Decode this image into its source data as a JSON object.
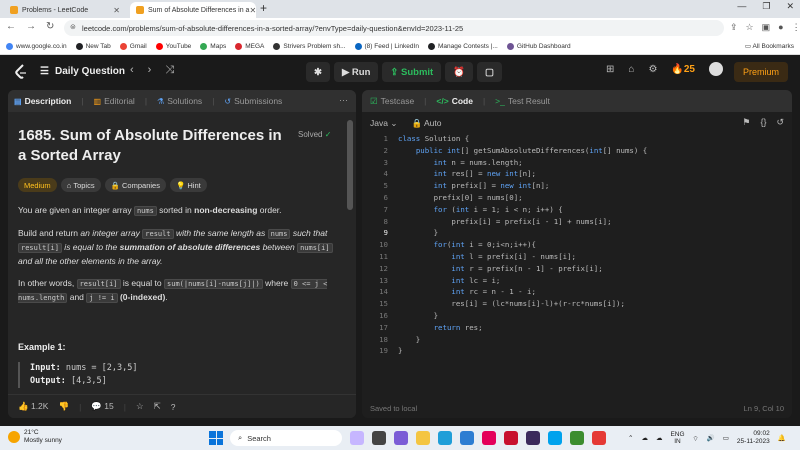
{
  "browser": {
    "tabs": [
      {
        "label": "Problems - LeetCode",
        "active": false
      },
      {
        "label": "Sum of Absolute Differences in a",
        "active": true
      }
    ],
    "url": "leetcode.com/problems/sum-of-absolute-differences-in-a-sorted-array/?envType=daily-question&envId=2023-11-25",
    "bookmarks": [
      {
        "label": "www.google.co.in",
        "color": "#4285f4"
      },
      {
        "label": "New Tab",
        "color": "#202124"
      },
      {
        "label": "Gmail",
        "color": "#ea4335"
      },
      {
        "label": "YouTube",
        "color": "#ff0000"
      },
      {
        "label": "Maps",
        "color": "#34a853"
      },
      {
        "label": "MEGA",
        "color": "#d9272e"
      },
      {
        "label": "Strivers Problem sh...",
        "color": "#333333"
      },
      {
        "label": "(8) Feed | LinkedIn",
        "color": "#0a66c2"
      },
      {
        "label": "Manage Contests |...",
        "color": "#202124"
      },
      {
        "label": "GitHub Dashboard",
        "color": "#6e5494"
      }
    ],
    "all_bookmarks": "All Bookmarks"
  },
  "header": {
    "title": "Daily Question",
    "run": "Run",
    "submit": "Submit",
    "streak": "25",
    "premium": "Premium"
  },
  "left_tabs": [
    "Description",
    "Editorial",
    "Solutions",
    "Submissions"
  ],
  "problem": {
    "title": "1685. Sum of Absolute Differences in a Sorted Array",
    "solved": "Solved",
    "tags": [
      "Medium",
      "Topics",
      "Companies",
      "Hint"
    ],
    "p1_a": "You are given an integer array ",
    "p1_code": "nums",
    "p1_b": " sorted in ",
    "p1_bold": "non-decreasing",
    "p1_c": " order.",
    "p2_a": "Build and return ",
    "p2_i1": "an integer array ",
    "p2_code1": "result",
    "p2_i2": " with the same length as ",
    "p2_code2": "nums",
    "p2_i3": " such that ",
    "p2_code3": "result[i]",
    "p2_i4": " is equal to the ",
    "p2_bold": "summation of absolute differences",
    "p2_i5": " between ",
    "p2_code4": "nums[i]",
    "p2_i6": " and all the other elements in the array.",
    "p3_a": "In other words, ",
    "p3_code1": "result[i]",
    "p3_b": " is equal to ",
    "p3_code2": "sum(|nums[i]-nums[j]|)",
    "p3_c": " where ",
    "p3_code3": "0 <= j < nums.length",
    "p3_d": " and ",
    "p3_code4": "j != i",
    "p3_bold": "(0-indexed)",
    "p3_e": ".",
    "example_title": "Example 1:",
    "input_label": "Input:",
    "input_value": "nums = [2,3,5]",
    "output_label": "Output:",
    "output_value": "[4,3,5]",
    "likes": "1.2K",
    "comments": "15"
  },
  "right_tabs": [
    "Testcase",
    "Code",
    "Test Result"
  ],
  "editor": {
    "language": "Java",
    "mode": "Auto",
    "saved": "Saved to local",
    "cursor": "Ln 9, Col 10",
    "lines": [
      "class Solution {",
      "    public int[] getSumAbsoluteDifferences(int[] nums) {",
      "        int n = nums.length;",
      "        int res[] = new int[n];",
      "        int prefix[] = new int[n];",
      "        prefix[0] = nums[0];",
      "        for (int i = 1; i < n; i++) {",
      "            prefix[i] = prefix[i - 1] + nums[i];",
      "        }",
      "        for(int i = 0;i<n;i++){",
      "            int l = prefix[i] - nums[i];",
      "            int r = prefix[n - 1] - prefix[i];",
      "            int lc = i;",
      "            int rc = n - 1 - i;",
      "            res[i] = (lc*nums[i]-l)+(r-rc*nums[i]);",
      "        }",
      "        return res;",
      "    }",
      "}"
    ]
  },
  "taskbar": {
    "temp": "21°C",
    "weather": "Mostly sunny",
    "search": "Search",
    "lang1": "ENG",
    "lang2": "IN",
    "time": "09:02",
    "date": "25-11-2023"
  }
}
